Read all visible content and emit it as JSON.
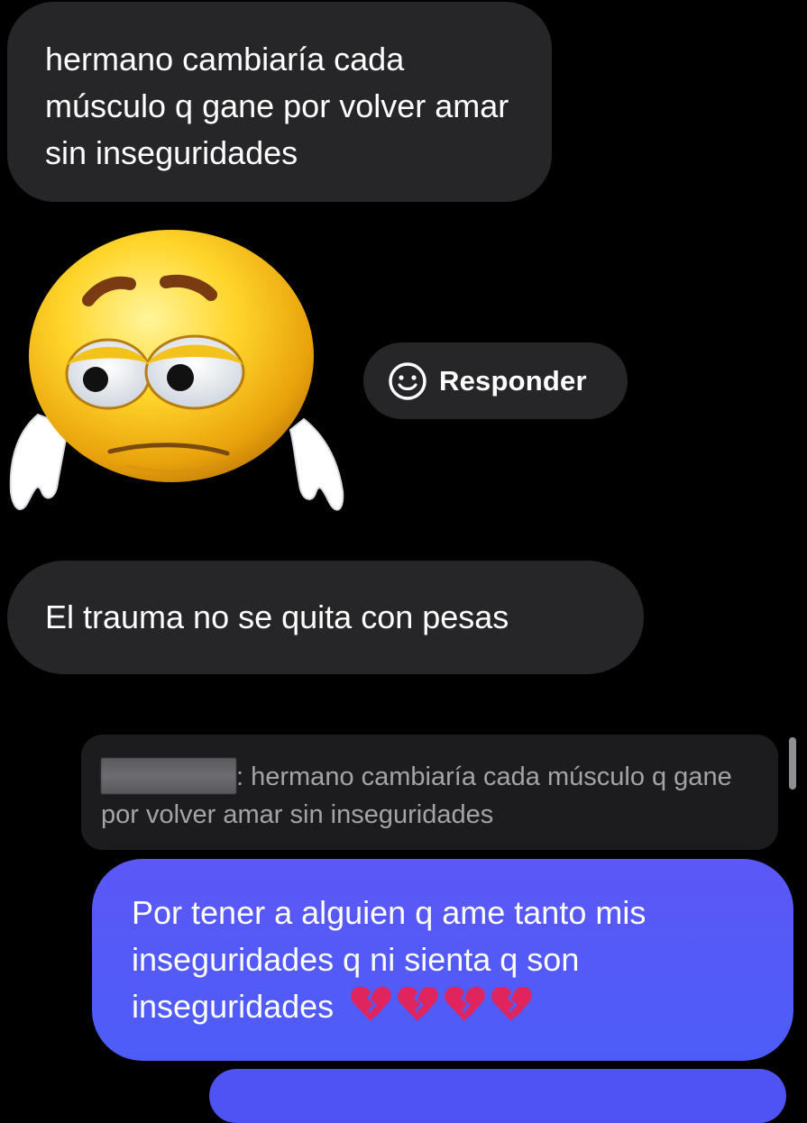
{
  "messages": [
    {
      "id": "msg1",
      "direction": "incoming",
      "text": "hermano cambiaría cada músculo q gane por volver amar sin inseguridades"
    },
    {
      "id": "sticker",
      "direction": "incoming",
      "sticker": "sad-smiley-face-sticker"
    },
    {
      "id": "msg2",
      "direction": "incoming",
      "text": "El trauma no se quita con pesas"
    },
    {
      "id": "msg3",
      "direction": "outgoing",
      "quote": {
        "author_redacted": true,
        "text": ": hermano cambiaría cada músculo q gane por volver amar sin inseguridades"
      },
      "text": "Por tener a alguien q ame tanto mis inseguridades q ni sienta q son inseguridades",
      "emoji": [
        "broken-heart-icon",
        "broken-heart-icon",
        "broken-heart-icon",
        "broken-heart-icon"
      ]
    }
  ],
  "actions": {
    "reply_label": "Responder",
    "reply_icon": "smiley-face-icon"
  },
  "colors": {
    "background": "#000000",
    "incoming_bubble": "#262628",
    "quote_bubble": "#1c1c1e",
    "outgoing_bubble": "#5b58f6",
    "broken_heart": "#e0245e"
  }
}
